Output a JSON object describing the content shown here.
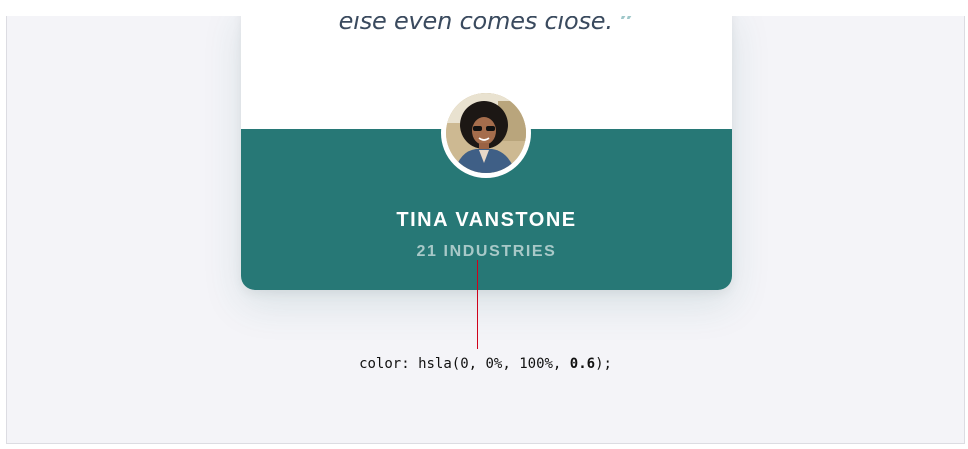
{
  "testimonial": {
    "quote_tail": "else even comes close.",
    "quote_mark": "”",
    "name": "TINA VANSTONE",
    "company": "21 INDUSTRIES",
    "colors": {
      "footer_bg": "#277876",
      "name_text": "#ffffff",
      "company_text": "rgba(255,255,255,0.6)",
      "quote_text": "#3a4a5e",
      "quote_mark": "#9ec7c9"
    }
  },
  "annotation": {
    "prefix": "color: hsla(0, 0%, 100%, ",
    "value": "0.6",
    "suffix": ");",
    "pointer_color": "#d0021b"
  },
  "icons": {
    "avatar": "person-photo-avatar"
  }
}
